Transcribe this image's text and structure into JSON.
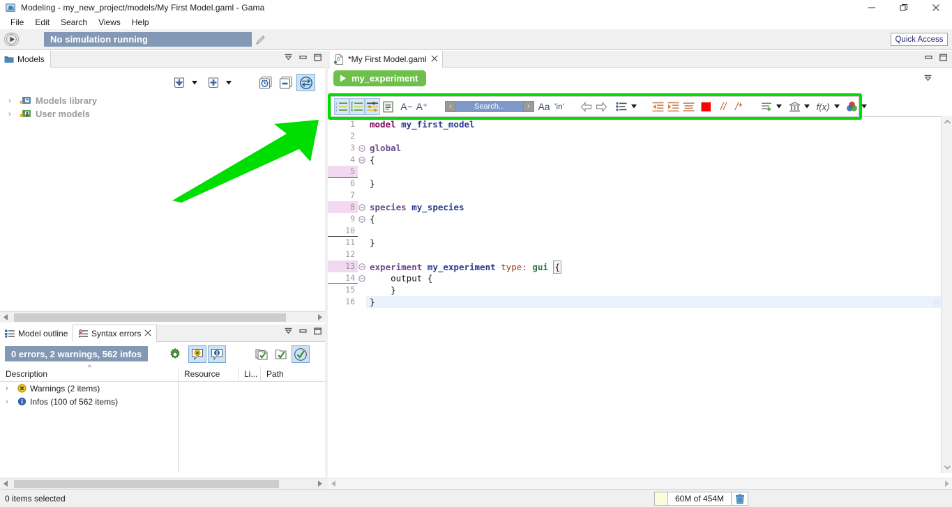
{
  "window": {
    "title": "Modeling - my_new_project/models/My First Model.gaml - Gama",
    "app_icon": "gama-icon",
    "minimize": "minimize-icon",
    "restore": "restore-icon",
    "close": "close-icon"
  },
  "menubar": {
    "items": [
      {
        "label": "File"
      },
      {
        "label": "Edit"
      },
      {
        "label": "Search"
      },
      {
        "label": "Views"
      },
      {
        "label": "Help"
      }
    ]
  },
  "coolbar": {
    "run_icon": "play-button-icon",
    "simulation_status": "No simulation running",
    "pencil_icon": "pencil-icon",
    "quick_access": "Quick Access"
  },
  "models_view": {
    "tab_label": "Models",
    "tab_icon": "folder-icon",
    "mini_buttons": [
      {
        "name": "minimize-view-icon"
      },
      {
        "name": "restore-view-icon"
      },
      {
        "name": "maximize-view-icon"
      }
    ],
    "toolbar": [
      {
        "name": "import-model-button",
        "icon": "download-arrow-icon",
        "caret": true,
        "active": false
      },
      {
        "name": "new-model-button",
        "icon": "plus-icon",
        "caret": true,
        "active": false
      },
      {
        "name": "show-recent-button",
        "icon": "clock-icon",
        "caret": false,
        "active": false
      },
      {
        "name": "collapse-all-button",
        "icon": "minus-stack-icon",
        "caret": false,
        "active": false
      },
      {
        "name": "link-with-editor-button",
        "icon": "sync-arrows-icon",
        "caret": false,
        "active": true
      }
    ],
    "tree": [
      {
        "label": "Models library",
        "icon": "locked-library-icon",
        "expanded": false
      },
      {
        "label": "User models",
        "icon": "user-models-icon",
        "expanded": false
      }
    ]
  },
  "problems_view": {
    "tabs": [
      {
        "label": "Model outline",
        "icon": "outline-icon",
        "active": false,
        "closable": false
      },
      {
        "label": "Syntax errors",
        "icon": "error-list-icon",
        "active": true,
        "closable": true
      }
    ],
    "summary": "0 errors, 2 warnings, 562 infos",
    "toolbar": [
      {
        "name": "preferences-button",
        "icon": "gear-icon",
        "active": false
      },
      {
        "name": "show-warnings-button",
        "icon": "warning-bubble-icon",
        "active": true
      },
      {
        "name": "show-infos-button",
        "icon": "info-bubble-icon",
        "active": true
      },
      {
        "name": "group-by-button",
        "icon": "folders-check-icon",
        "active": false
      },
      {
        "name": "filter-button",
        "icon": "folder-check-icon",
        "active": false
      },
      {
        "name": "validate-button",
        "icon": "circle-check-icon",
        "active": true
      }
    ],
    "columns": [
      {
        "label": "Description",
        "sorted": true,
        "sort_icon": "sort-asc-caret"
      },
      {
        "label": "Resource",
        "sorted": false
      },
      {
        "label": "Li...",
        "sorted": false
      },
      {
        "label": "Path",
        "sorted": false
      }
    ],
    "rows": [
      {
        "label": "Warnings (2 items)",
        "icon": "warning-icon",
        "expanded": false
      },
      {
        "label": "Infos (100 of 562 items)",
        "icon": "info-icon",
        "expanded": false
      }
    ]
  },
  "editor": {
    "tab_label": "*My First Model.gaml",
    "tab_icon": "gaml-file-icon",
    "tab_close": "close-tab-icon",
    "experiment_button": "my_experiment",
    "experiment_play_icon": "play-triangle-icon",
    "fold_icon": "collapse-icon",
    "toolbar": [
      {
        "name": "toggle-outline-button",
        "icon": "numbered-list-icon",
        "active": true,
        "caret": false
      },
      {
        "name": "toggle-markers-button",
        "icon": "ordered-list-icon",
        "active": true,
        "caret": false
      },
      {
        "name": "toggle-overview-button",
        "icon": "settings-list-icon",
        "active": true,
        "caret": false
      },
      {
        "name": "wrap-text-button",
        "icon": "document-lines-icon",
        "active": false,
        "caret": false
      },
      {
        "name": "decrease-font-button",
        "icon": "font-decrease-icon",
        "label": "A−",
        "active": false,
        "caret": false
      },
      {
        "name": "increase-font-button",
        "icon": "font-increase-icon",
        "label": "A⁺",
        "active": false,
        "caret": false
      },
      {
        "name": "search-previous-button",
        "icon": "chevron-left-icon",
        "active": false,
        "caret": false
      },
      {
        "name": "search-input",
        "icon": "search-field",
        "placeholder": "Search...",
        "value": "",
        "active": false,
        "caret": false
      },
      {
        "name": "search-next-button",
        "icon": "chevron-right-icon",
        "active": false,
        "caret": false
      },
      {
        "name": "match-case-button",
        "icon": "match-case-icon",
        "label": "Aa",
        "active": false,
        "caret": false
      },
      {
        "name": "whole-word-button",
        "icon": "whole-word-icon",
        "label": "'in'",
        "active": false,
        "caret": false
      },
      {
        "name": "navigate-back-button",
        "icon": "arrow-left-outline-icon",
        "active": false,
        "caret": false
      },
      {
        "name": "navigate-forward-button",
        "icon": "arrow-right-outline-icon",
        "active": false,
        "caret": false
      },
      {
        "name": "templates-button",
        "icon": "bullet-list-icon",
        "active": false,
        "caret": true
      },
      {
        "name": "outdent-button",
        "icon": "outdent-icon",
        "active": false,
        "caret": false
      },
      {
        "name": "indent-button",
        "icon": "indent-icon",
        "active": false,
        "caret": false
      },
      {
        "name": "format-button",
        "icon": "format-lines-icon",
        "active": false,
        "caret": false
      },
      {
        "name": "color-picker-button",
        "icon": "red-square-icon",
        "active": false,
        "caret": false
      },
      {
        "name": "line-comment-button",
        "icon": "line-comment-icon",
        "label": "//",
        "active": false,
        "caret": false
      },
      {
        "name": "block-comment-button",
        "icon": "block-comment-icon",
        "label": "/*",
        "active": false,
        "caret": false
      },
      {
        "name": "insert-statement-button",
        "icon": "add-lines-icon",
        "active": false,
        "caret": true
      },
      {
        "name": "insert-builtin-button",
        "icon": "bank-icon",
        "active": false,
        "caret": true
      },
      {
        "name": "insert-operator-button",
        "icon": "function-icon",
        "label": "f(x)",
        "active": false,
        "caret": true
      },
      {
        "name": "insert-color-button",
        "icon": "color-circles-icon",
        "active": false,
        "caret": true
      }
    ],
    "code_lines": [
      {
        "n": 1,
        "fold": "",
        "changed": false,
        "underline": false,
        "current": false,
        "tokens": [
          {
            "t": "model ",
            "c": "kw"
          },
          {
            "t": "my_first_model",
            "c": "name"
          }
        ]
      },
      {
        "n": 2,
        "fold": "",
        "changed": false,
        "underline": false,
        "current": false,
        "tokens": []
      },
      {
        "n": 3,
        "fold": "-",
        "changed": false,
        "underline": false,
        "current": false,
        "tokens": [
          {
            "t": "global",
            "c": "kwb"
          }
        ]
      },
      {
        "n": 4,
        "fold": "-",
        "changed": false,
        "underline": false,
        "current": false,
        "tokens": [
          {
            "t": "{",
            "c": "pl"
          }
        ]
      },
      {
        "n": 5,
        "fold": "",
        "changed": true,
        "underline": true,
        "current": false,
        "tokens": []
      },
      {
        "n": 6,
        "fold": "",
        "changed": false,
        "underline": false,
        "current": false,
        "tokens": [
          {
            "t": "}",
            "c": "pl"
          }
        ]
      },
      {
        "n": 7,
        "fold": "",
        "changed": false,
        "underline": false,
        "current": false,
        "tokens": []
      },
      {
        "n": 8,
        "fold": "-",
        "changed": true,
        "underline": false,
        "current": false,
        "tokens": [
          {
            "t": "species ",
            "c": "kwb"
          },
          {
            "t": "my_species",
            "c": "name"
          }
        ]
      },
      {
        "n": 9,
        "fold": "-",
        "changed": false,
        "underline": false,
        "current": false,
        "tokens": [
          {
            "t": "{",
            "c": "pl"
          }
        ]
      },
      {
        "n": 10,
        "fold": "",
        "changed": false,
        "underline": true,
        "current": false,
        "tokens": []
      },
      {
        "n": 11,
        "fold": "",
        "changed": false,
        "underline": false,
        "current": false,
        "tokens": [
          {
            "t": "}",
            "c": "pl"
          }
        ]
      },
      {
        "n": 12,
        "fold": "",
        "changed": false,
        "underline": false,
        "current": false,
        "tokens": []
      },
      {
        "n": 13,
        "fold": "-",
        "changed": true,
        "underline": false,
        "current": false,
        "tokens": [
          {
            "t": "experiment ",
            "c": "kwb"
          },
          {
            "t": "my_experiment ",
            "c": "name"
          },
          {
            "t": "type: ",
            "c": "facet"
          },
          {
            "t": "gui ",
            "c": "val"
          },
          {
            "t": "{",
            "c": "caret"
          }
        ]
      },
      {
        "n": 14,
        "fold": "-",
        "changed": false,
        "underline": true,
        "current": false,
        "tokens": [
          {
            "t": "    output {",
            "c": "pl"
          }
        ]
      },
      {
        "n": 15,
        "fold": "",
        "changed": false,
        "underline": false,
        "current": false,
        "tokens": [
          {
            "t": "    }",
            "c": "pl"
          }
        ]
      },
      {
        "n": 16,
        "fold": "",
        "changed": false,
        "underline": false,
        "current": true,
        "tokens": [
          {
            "t": "}",
            "c": "pl"
          }
        ]
      }
    ]
  },
  "statusbar": {
    "selection_text": "0 items selected",
    "heap_label": "60M of 454M",
    "trash_icon": "trash-icon"
  },
  "annotations": {
    "arrow": "green-arrow-annotation",
    "highlight_box": "green-highlight-box"
  },
  "colors": {
    "accent_blue": "#8398b5",
    "green_highlight": "#00dd00",
    "experiment_green": "#6ec04a",
    "active_toolbar": "#cce3f7",
    "search_field": "#8098c8"
  }
}
